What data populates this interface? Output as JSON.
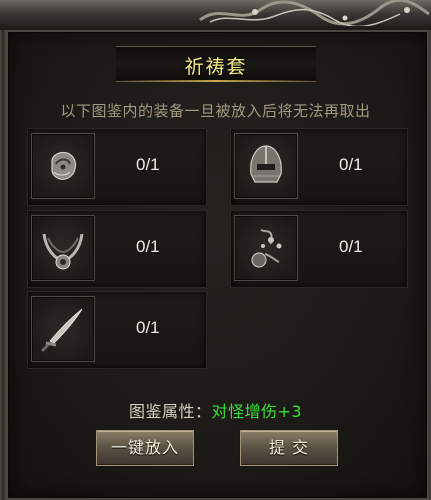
{
  "title": "祈祷套",
  "notice": "以下图鉴内的装备一旦被放入后将无法再取出",
  "slots": [
    {
      "icon": "gauntlet-icon",
      "count": "0/1"
    },
    {
      "icon": "helmet-icon",
      "count": "0/1"
    },
    {
      "icon": "necklace-icon",
      "count": "0/1"
    },
    {
      "icon": "bracelet-icon",
      "count": "0/1"
    },
    {
      "icon": "sword-icon",
      "count": "0/1"
    }
  ],
  "attribute": {
    "label": "图鉴属性：",
    "value": "对怪增伤+3"
  },
  "buttons": {
    "auto_fill": "一键放入",
    "submit": "提 交"
  },
  "colors": {
    "title": "#f3e88a",
    "attribute_value": "#38e03a",
    "notice": "#a39a82"
  }
}
